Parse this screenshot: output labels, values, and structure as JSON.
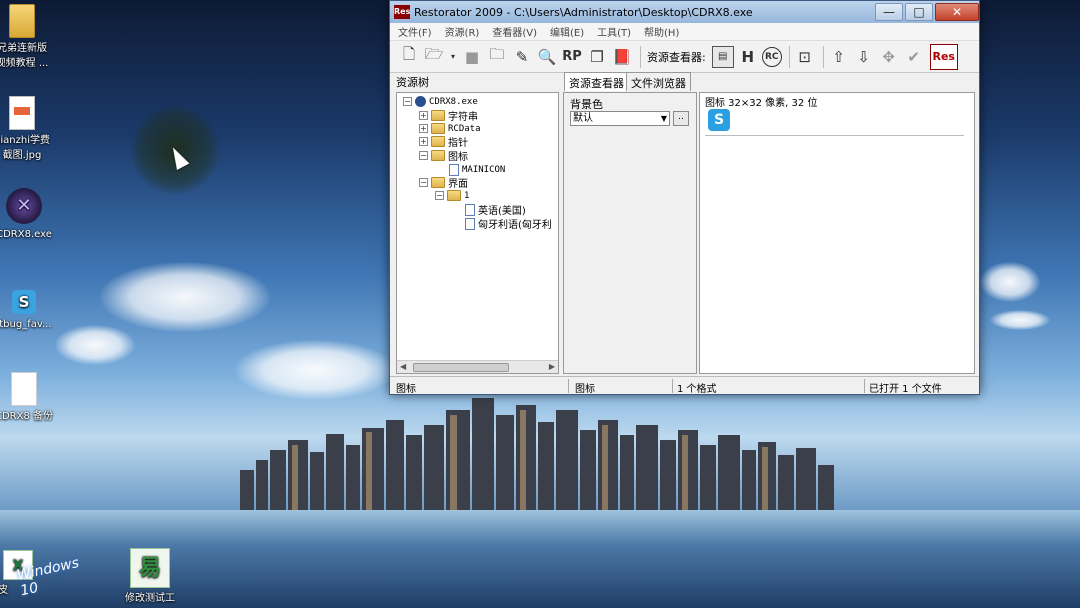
{
  "window": {
    "app_logo": "Res",
    "title": "Restorator 2009 - C:\\Users\\Administrator\\Desktop\\CDRX8.exe",
    "controls": {
      "minimize": "—",
      "maximize": "□",
      "close": "✕"
    }
  },
  "menu": [
    "文件(F)",
    "资源(R)",
    "查看器(V)",
    "编辑(E)",
    "工具(T)",
    "帮助(H)"
  ],
  "toolbar": {
    "viewer_label": "资源查看器:",
    "rp_label": "RP",
    "rc_label": "RC",
    "logo": "Res"
  },
  "panes": {
    "tree_title": "资源树",
    "tabs": [
      "资源查看器",
      "文件浏览器"
    ]
  },
  "tree": {
    "root": "CDRX8.exe",
    "strings": "字符串",
    "rcdata": "RCData",
    "cursor": "指针",
    "icon": "图标",
    "mainicon": "MAINICON",
    "ui": "界面",
    "ui_1": "1",
    "lang_en": "英语(美国)",
    "lang_pt": "匈牙利语(匈牙利"
  },
  "middle": {
    "bg_label": "背景色",
    "bg_value": "默认",
    "browse": ".."
  },
  "right": {
    "info": "图标 32×32 像素, 32 位",
    "icon_letter": "S"
  },
  "status": {
    "left": "图标",
    "type": "图标",
    "formats": "1 个格式",
    "opened": "已打开 1 个文件"
  },
  "desktop": {
    "icons": [
      {
        "label": "兄弟连新版\n视频教程 ..."
      },
      {
        "label": "qianzhi学费\n截图.jpg"
      },
      {
        "label": "CDRX8.exe"
      },
      {
        "label": "itbug_fav..."
      },
      {
        "label": "CDRX8 备份"
      },
      {
        "label": "修改测试工"
      },
      {
        "label": "皮"
      }
    ],
    "win10_text": "Windows 10"
  }
}
